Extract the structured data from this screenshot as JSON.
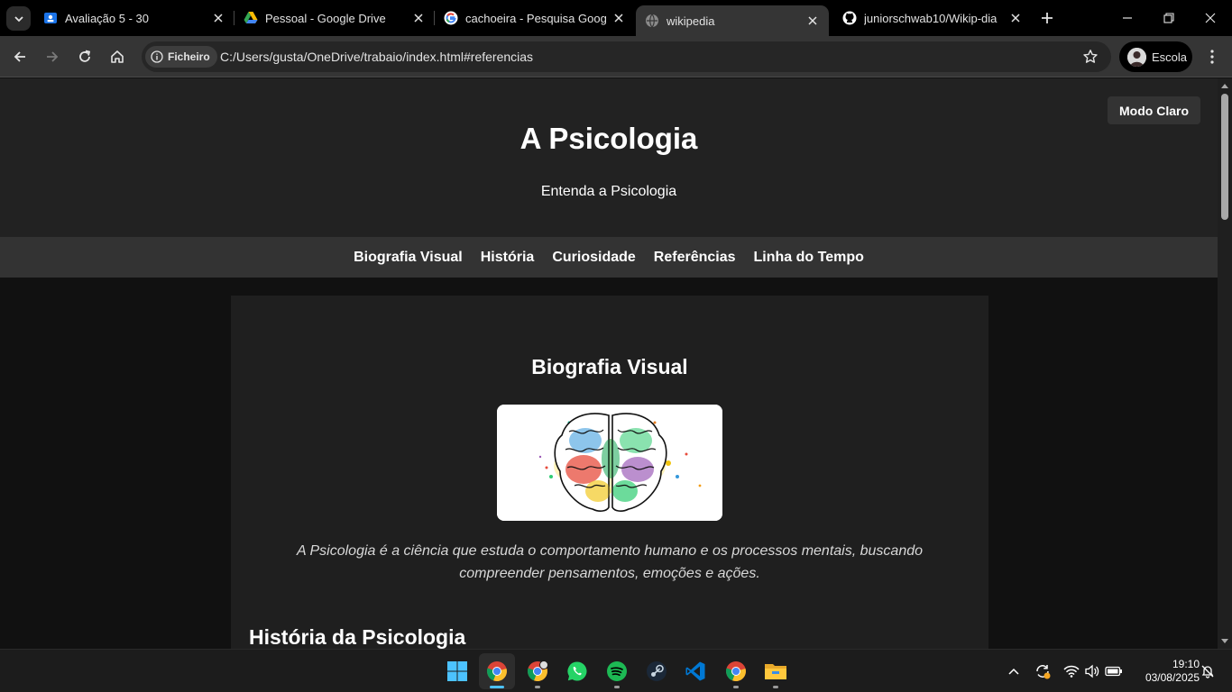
{
  "browser": {
    "tabs": [
      {
        "title": "Avaliação 5 - 30",
        "favicon": "classroom-icon"
      },
      {
        "title": "Pessoal - Google Drive",
        "favicon": "google-drive-icon"
      },
      {
        "title": "cachoeira - Pesquisa Google",
        "favicon": "google-icon"
      },
      {
        "title": "wikipedia",
        "favicon": "globe-icon",
        "active": true
      },
      {
        "title": "juniorschwab10/Wikip-dia",
        "favicon": "github-icon"
      }
    ],
    "address": {
      "chip_label": "Ficheiro",
      "url": "C:/Users/gusta/OneDrive/trabaio/index.html#referencias"
    },
    "profile_label": "Escola"
  },
  "page": {
    "header": {
      "title": "A Psicologia",
      "subtitle": "Entenda a Psicologia",
      "mode_button": "Modo Claro"
    },
    "nav": [
      "Biografia Visual",
      "História",
      "Curiosidade",
      "Referências",
      "Linha do Tempo"
    ],
    "biografia": {
      "title": "Biografia Visual",
      "image_desc": "colorful-brain-illustration",
      "caption": "A Psicologia é a ciência que estuda o comportamento humano e os processos mentais, buscando compreender pensamentos, emoções e ações."
    },
    "historia": {
      "title": "História da Psicologia"
    }
  },
  "taskbar": {
    "apps": [
      "start-icon",
      "chrome-icon",
      "chrome-profile-icon",
      "whatsapp-icon",
      "spotify-icon",
      "steam-icon",
      "vscode-icon",
      "chrome-icon-2",
      "file-explorer-icon"
    ],
    "clock": {
      "time": "19:10",
      "date": "03/08/2025"
    }
  },
  "colors": {
    "header_bg": "#222222",
    "nav_bg": "#333333",
    "content_bg": "#1f1f1f",
    "page_bg": "#111111"
  }
}
